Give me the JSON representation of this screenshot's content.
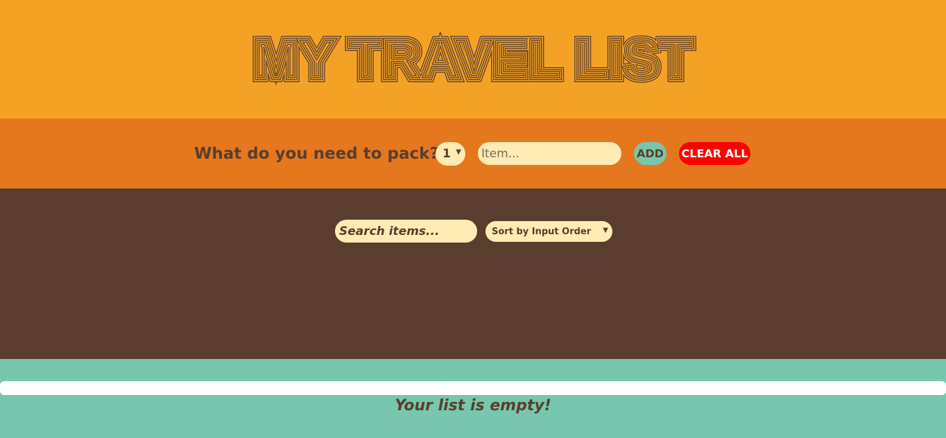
{
  "header": {
    "title": "MY TRAVEL LIST"
  },
  "form": {
    "question": "What do you need to pack?",
    "quantity_value": "1",
    "item_placeholder": "Item...",
    "add_label": "ADD",
    "clear_label": "CLEAR ALL"
  },
  "list": {
    "search_placeholder": "Search items...",
    "sort_selected": "Sort by Input Order"
  },
  "stats": {
    "progress_fraction": 0,
    "message": "Your list is empty!"
  },
  "colors": {
    "header_bg": "#f4a226",
    "form_bg": "#e5771f",
    "list_bg": "#5a3d2e",
    "stats_bg": "#76c7ad",
    "text_brown": "#5a3e2b",
    "input_bg": "#ffebb3",
    "clear_button": "#ff0000"
  },
  "icons": {
    "select_arrow": "chevron-down-icon"
  }
}
